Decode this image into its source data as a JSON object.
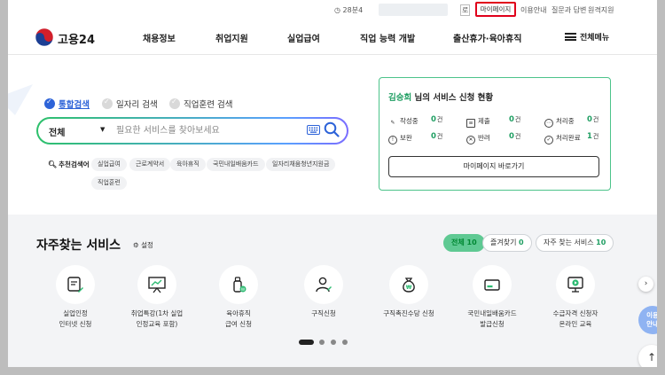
{
  "utility": {
    "left_text": "28분4",
    "right_fragment": "로",
    "mypage": "마이페이지",
    "guide": "이용안내",
    "qa": "질문과 답변",
    "remote": "원격지원"
  },
  "header": {
    "logo_text": "고용24",
    "nav": [
      "채용정보",
      "취업지원",
      "실업급여",
      "직업 능력 개발",
      "출산휴가·육아휴직"
    ],
    "menu_label": "전체메뉴"
  },
  "search": {
    "options": [
      "통합검색",
      "일자리 검색",
      "직업훈련 검색"
    ],
    "scope": "전체",
    "placeholder": "필요한 서비스를 찾아보세요",
    "rec_label": "추천검색어",
    "chips": [
      "실업급여",
      "근로계약서",
      "육아휴직",
      "국민내일배움카드",
      "일자리채움청년지원금",
      "직업훈련"
    ]
  },
  "status": {
    "user_name": "김승희",
    "title_suffix": " 님의 서비스 신청 현황",
    "unit": "건",
    "items": [
      {
        "label": "작성중",
        "count": "0"
      },
      {
        "label": "제출",
        "count": "0"
      },
      {
        "label": "처리중",
        "count": "0"
      },
      {
        "label": "보완",
        "count": "0"
      },
      {
        "label": "반려",
        "count": "0"
      },
      {
        "label": "처리완료",
        "count": "1"
      }
    ],
    "button": "마이페이지 바로가기"
  },
  "frequent": {
    "title": "자주찾는 서비스",
    "settings": "설정",
    "tabs": [
      {
        "label": "전체",
        "count": "10"
      },
      {
        "label": "즐겨찾기",
        "count": "0"
      },
      {
        "label": "자주 찾는 서비스",
        "count": "10"
      }
    ],
    "services": [
      {
        "line1": "실업인정",
        "line2": "인터넷 신청",
        "icon": "document-pen-icon"
      },
      {
        "line1": "취업특강(1차 실업",
        "line2": "인정교육 포함)",
        "icon": "presentation-board-icon"
      },
      {
        "line1": "육아휴직",
        "line2": "급여 신청",
        "icon": "baby-bottle-icon"
      },
      {
        "line1": "구직신청",
        "line2": "",
        "icon": "person-pen-icon"
      },
      {
        "line1": "구직촉진수당 신청",
        "line2": "",
        "icon": "money-bag-icon"
      },
      {
        "line1": "국민내일배움카드",
        "line2": "발급신청",
        "icon": "card-icon"
      },
      {
        "line1": "수급자격 신청자",
        "line2": "온라인 교육",
        "icon": "video-monitor-icon"
      }
    ],
    "help": "이용\n안내"
  },
  "colors": {
    "accent_green": "#1f9e62",
    "accent_blue": "#2d63d8",
    "highlight_red": "#e0001b"
  }
}
